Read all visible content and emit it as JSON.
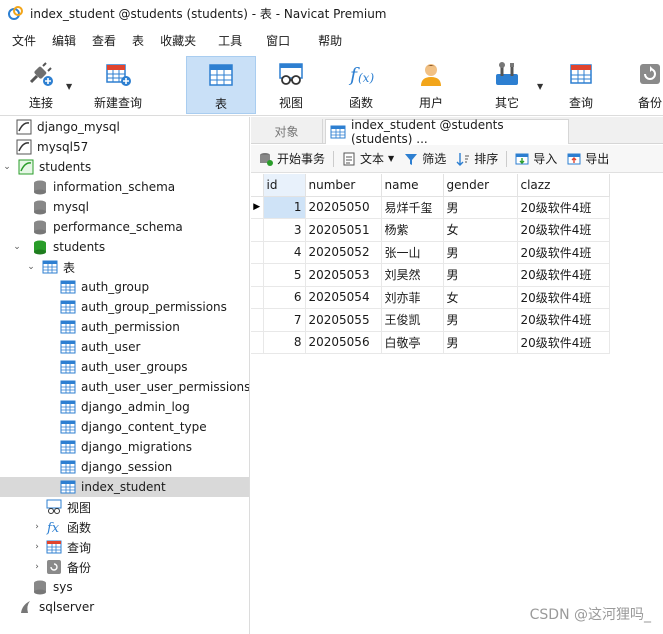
{
  "window": {
    "title": "index_student @students (students) - 表 - Navicat Premium"
  },
  "menu": [
    "文件",
    "编辑",
    "查看",
    "表",
    "收藏夹",
    "工具",
    "窗口",
    "帮助"
  ],
  "toolbar": {
    "items": [
      {
        "label": "连接",
        "icon": "plug-connect-icon"
      },
      {
        "label": "新建查询",
        "icon": "new-query-icon"
      },
      {
        "label": "表",
        "icon": "table-icon",
        "active": true
      },
      {
        "label": "视图",
        "icon": "view-glasses-icon"
      },
      {
        "label": "函数",
        "icon": "function-fx-icon"
      },
      {
        "label": "用户",
        "icon": "user-icon"
      },
      {
        "label": "其它",
        "icon": "tools-icon"
      },
      {
        "label": "查询",
        "icon": "query-icon"
      },
      {
        "label": "备份",
        "icon": "backup-icon"
      }
    ],
    "colors": {
      "active_bg": "#c9e0f7"
    }
  },
  "nav": {
    "connections": [
      {
        "label": "django_mysql"
      },
      {
        "label": "mysql57"
      },
      {
        "label": "students"
      }
    ],
    "databases": [
      "information_schema",
      "mysql",
      "performance_schema",
      "students"
    ],
    "tables_group": "表",
    "tables": [
      "auth_group",
      "auth_group_permissions",
      "auth_permission",
      "auth_user",
      "auth_user_groups",
      "auth_user_user_permissions",
      "django_admin_log",
      "django_content_type",
      "django_migrations",
      "django_session",
      "index_student"
    ],
    "selected_table": "index_student",
    "other_groups": [
      "视图",
      "函数",
      "查询",
      "备份"
    ],
    "after_db": "sys",
    "last_connection": "sqlserver"
  },
  "tabs": {
    "objects": "对象",
    "active": "index_student @students (students) ..."
  },
  "subtoolbar": {
    "begin_transaction": "开始事务",
    "text": "文本",
    "filter": "筛选",
    "sort": "排序",
    "import": "导入",
    "export": "导出"
  },
  "grid": {
    "columns": [
      "id",
      "number",
      "name",
      "gender",
      "clazz"
    ],
    "rows": [
      {
        "id": "1",
        "number": "20205050",
        "name": "易烊千玺",
        "gender": "男",
        "clazz": "20级软件4班"
      },
      {
        "id": "3",
        "number": "20205051",
        "name": "杨紫",
        "gender": "女",
        "clazz": "20级软件4班"
      },
      {
        "id": "4",
        "number": "20205052",
        "name": "张一山",
        "gender": "男",
        "clazz": "20级软件4班"
      },
      {
        "id": "5",
        "number": "20205053",
        "name": "刘昊然",
        "gender": "男",
        "clazz": "20级软件4班"
      },
      {
        "id": "6",
        "number": "20205054",
        "name": "刘亦菲",
        "gender": "女",
        "clazz": "20级软件4班"
      },
      {
        "id": "7",
        "number": "20205055",
        "name": "王俊凯",
        "gender": "男",
        "clazz": "20级软件4班"
      },
      {
        "id": "8",
        "number": "20205056",
        "name": "白敬亭",
        "gender": "男",
        "clazz": "20级软件4班"
      }
    ]
  },
  "watermark": "CSDN @这河狸吗_"
}
